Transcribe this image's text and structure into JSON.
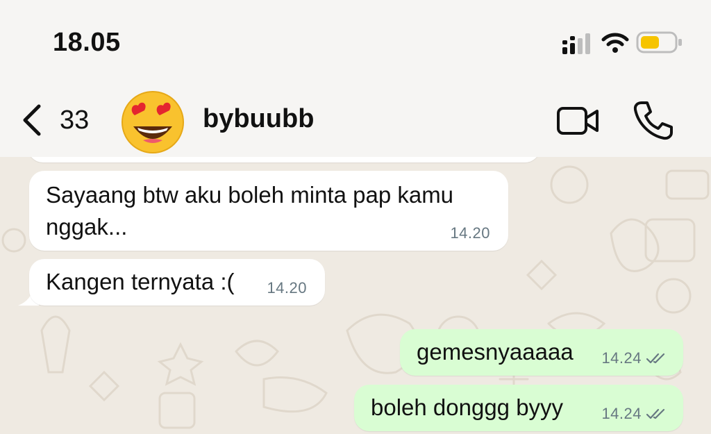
{
  "status_bar": {
    "time": "18.05"
  },
  "header": {
    "back_count": "33",
    "contact_name": "bybuubb",
    "avatar_emoji": "😍"
  },
  "messages": [
    {
      "direction": "incoming",
      "text": "Sayaang btw aku boleh minta pap kamu nggak...",
      "time": "14.20"
    },
    {
      "direction": "incoming",
      "text": "Kangen ternyata :(",
      "time": "14.20"
    },
    {
      "direction": "outgoing",
      "text": "gemesnyaaaaa",
      "time": "14.24",
      "read": true
    },
    {
      "direction": "outgoing",
      "text": "boleh donggg byyy",
      "time": "14.24",
      "read": true
    }
  ],
  "colors": {
    "chat_background": "#efeae2",
    "incoming_bubble": "#ffffff",
    "outgoing_bubble": "#d9fdd3",
    "timestamp": "#667781",
    "battery_fill": "#f6c400"
  }
}
